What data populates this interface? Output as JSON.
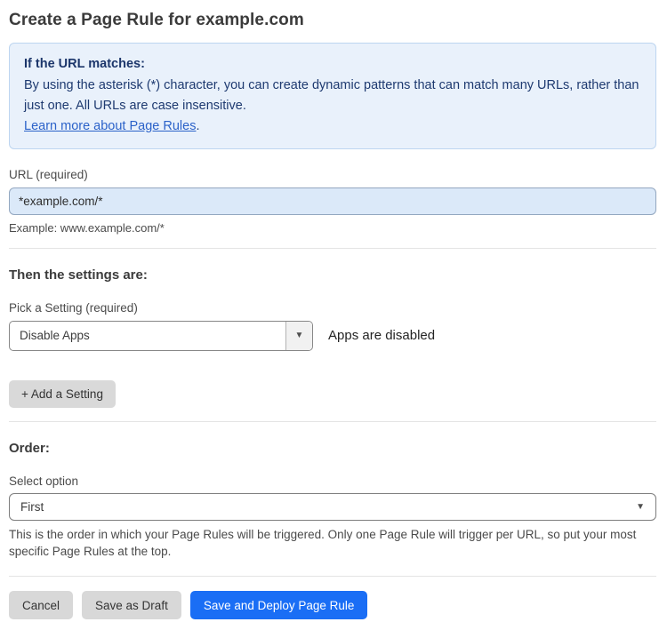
{
  "page": {
    "title": "Create a Page Rule for example.com"
  },
  "info_box": {
    "heading": "If the URL matches:",
    "body": "By using the asterisk (*) character, you can create dynamic patterns that can match many URLs, rather than just one. All URLs are case insensitive.",
    "link_text": "Learn more about Page Rules",
    "link_suffix": "."
  },
  "url_field": {
    "label": "URL (required)",
    "value": "*example.com/*",
    "example": "Example: www.example.com/*"
  },
  "settings": {
    "heading": "Then the settings are:",
    "picker_label": "Pick a Setting (required)",
    "selected_setting": "Disable Apps",
    "status_text": "Apps are disabled",
    "add_button_label": "+ Add a Setting"
  },
  "order": {
    "heading": "Order:",
    "label": "Select option",
    "selected_option": "First",
    "help_text": "This is the order in which your Page Rules will be triggered. Only one Page Rule will trigger per URL, so put your most specific Page Rules at the top."
  },
  "actions": {
    "cancel_label": "Cancel",
    "save_draft_label": "Save as Draft",
    "save_deploy_label": "Save and Deploy Page Rule"
  },
  "icons": {
    "dropdown_caret": "▼"
  },
  "colors": {
    "accent_blue": "#1a6ef5",
    "info_box_bg": "#e9f1fb",
    "info_box_border": "#bdd5f0",
    "info_text": "#1e3a70",
    "link_blue": "#2b62c9",
    "url_input_bg": "#dbe9f9",
    "gray_button_bg": "#d8d8d8"
  }
}
